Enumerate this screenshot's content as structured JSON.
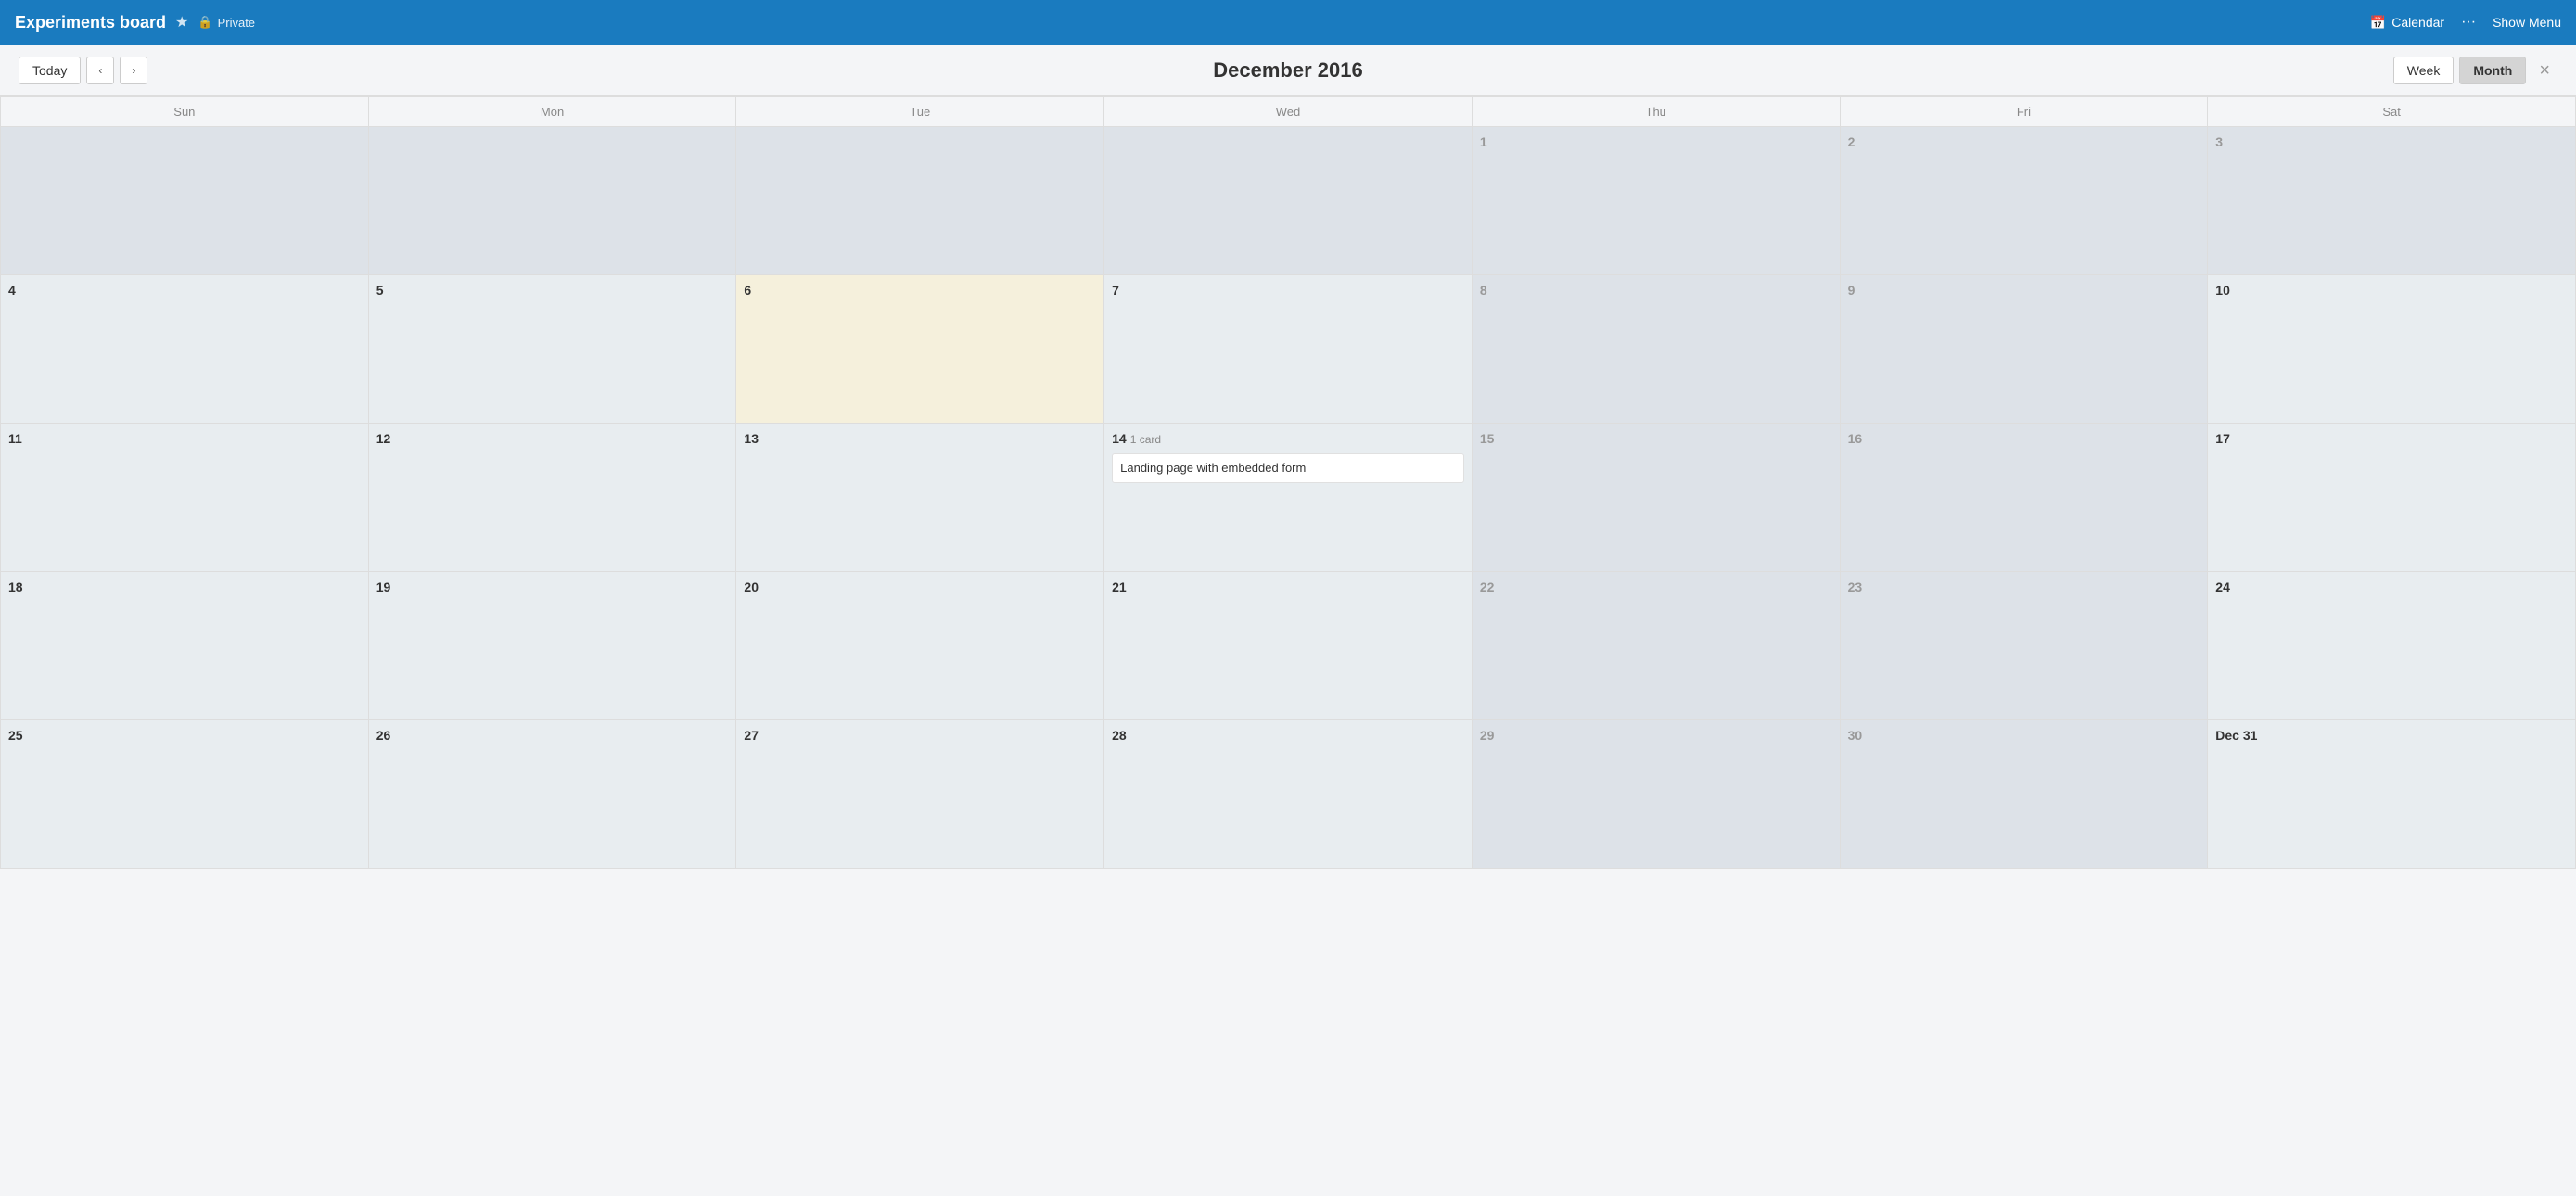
{
  "topbar": {
    "title": "Experiments board",
    "star_label": "★",
    "lock_icon": "🔒",
    "private_label": "Private",
    "calendar_icon": "📅",
    "calendar_link": "Calendar",
    "dots": "···",
    "show_menu": "Show Menu"
  },
  "toolbar": {
    "today_label": "Today",
    "prev_label": "‹",
    "next_label": "›",
    "title": "December 2016",
    "week_label": "Week",
    "month_label": "Month",
    "close_label": "×"
  },
  "day_headers": [
    "Sun",
    "Mon",
    "Tue",
    "Wed",
    "Thu",
    "Fri",
    "Sat"
  ],
  "weeks": [
    [
      {
        "date": "",
        "other": true
      },
      {
        "date": "",
        "other": true
      },
      {
        "date": "",
        "other": true
      },
      {
        "date": "",
        "other": true
      },
      {
        "date": "1",
        "other": true
      },
      {
        "date": "2",
        "other": true
      },
      {
        "date": "3",
        "other": true
      }
    ],
    [
      {
        "date": "4"
      },
      {
        "date": "5"
      },
      {
        "date": "6",
        "today": true
      },
      {
        "date": "7"
      },
      {
        "date": "8",
        "other": true
      },
      {
        "date": "9",
        "other": true
      },
      {
        "date": "10"
      }
    ],
    [
      {
        "date": "11"
      },
      {
        "date": "12"
      },
      {
        "date": "13"
      },
      {
        "date": "14",
        "event": {
          "count": "1 card",
          "title": "Landing page with embedded form"
        }
      },
      {
        "date": "15",
        "other": true
      },
      {
        "date": "16",
        "other": true
      },
      {
        "date": "17"
      }
    ],
    [
      {
        "date": "18"
      },
      {
        "date": "19"
      },
      {
        "date": "20"
      },
      {
        "date": "21"
      },
      {
        "date": "22",
        "other": true
      },
      {
        "date": "23",
        "other": true
      },
      {
        "date": "24"
      }
    ],
    [
      {
        "date": "25"
      },
      {
        "date": "26"
      },
      {
        "date": "27"
      },
      {
        "date": "28"
      },
      {
        "date": "29",
        "other": true
      },
      {
        "date": "30",
        "other": true
      },
      {
        "date": "Dec 31",
        "last": true
      }
    ]
  ]
}
